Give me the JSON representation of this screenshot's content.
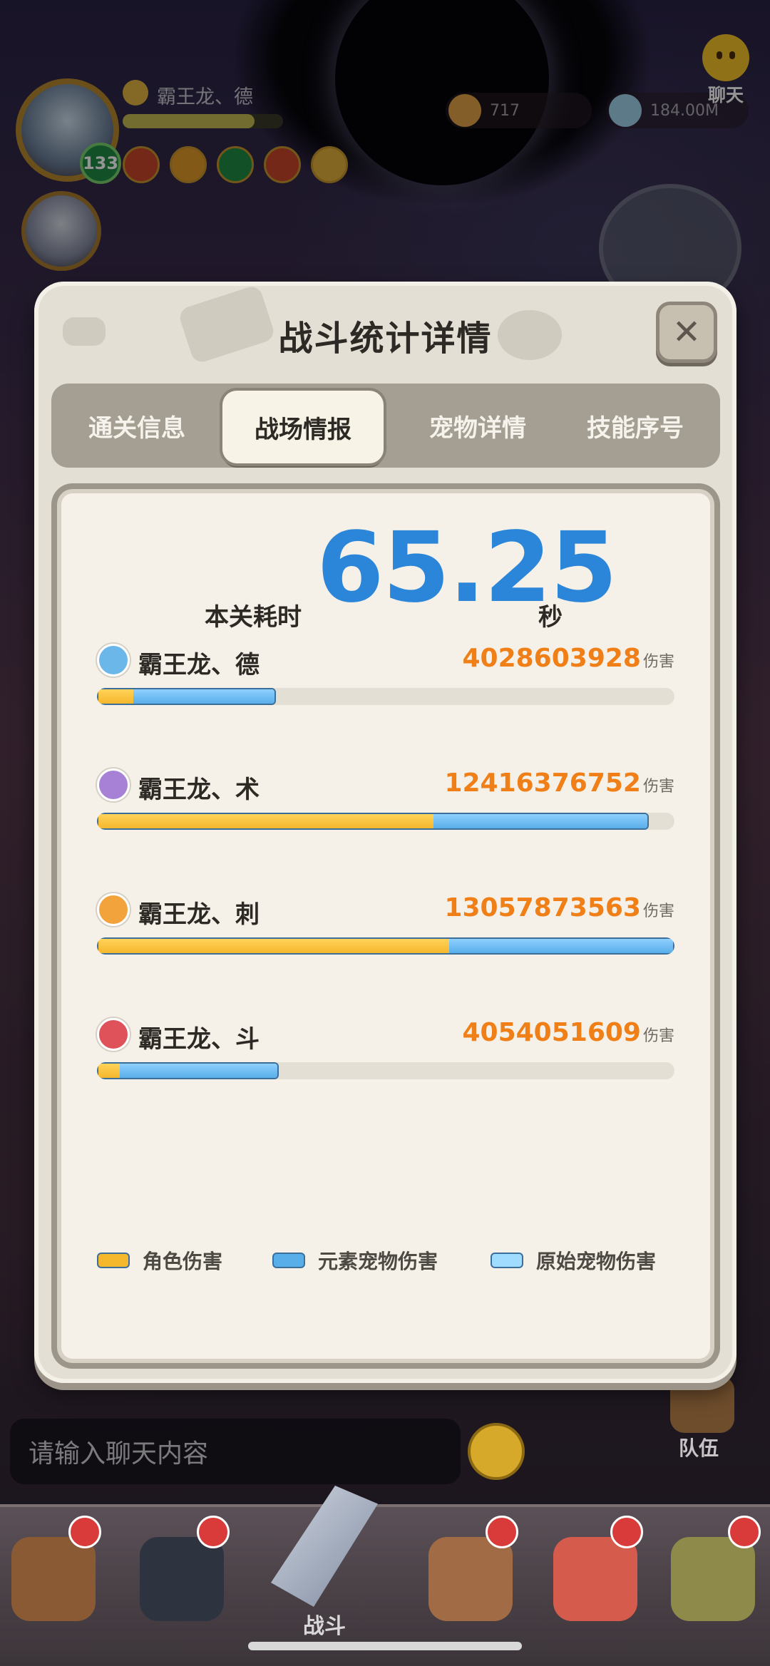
{
  "background": {
    "player_name": "霸王龙、德",
    "level": "133",
    "resource_gold": "717",
    "resource_gems": "184.00M",
    "chat_button": "聊天",
    "chat_placeholder": "请输入聊天内容",
    "team_label": "队伍"
  },
  "modal": {
    "title": "战斗统计详情",
    "close": "✕",
    "tabs": [
      {
        "label": "通关信息",
        "active": false
      },
      {
        "label": "战场情报",
        "active": true
      },
      {
        "label": "宠物详情",
        "active": false
      },
      {
        "label": "技能序号",
        "active": false
      }
    ],
    "time_label": "本关耗时",
    "time_value": "65.25",
    "time_unit": "秒",
    "damage_unit": "伤害",
    "heroes": [
      {
        "name": "霸王龙、德",
        "damage": "4028603928",
        "icon_color": "#6bb7ea",
        "icon": "water-element-icon",
        "bar_total": 0.31,
        "yellow_share": 0.2
      },
      {
        "name": "霸王龙、术",
        "damage": "12416376752",
        "icon_color": "#a781d6",
        "icon": "arcane-element-icon",
        "bar_total": 0.955,
        "yellow_share": 0.61
      },
      {
        "name": "霸王龙、刺",
        "damage": "13057873563",
        "icon_color": "#f2a33c",
        "icon": "fire-element-icon",
        "bar_total": 1.0,
        "yellow_share": 0.61
      },
      {
        "name": "霸王龙、斗",
        "damage": "4054051609",
        "icon_color": "#e0525a",
        "icon": "blood-element-icon",
        "bar_total": 0.315,
        "yellow_share": 0.12
      }
    ],
    "legend": [
      {
        "label": "角色伤害",
        "color": "#f5b72c"
      },
      {
        "label": "元素宠物伤害",
        "color": "#58aee9"
      },
      {
        "label": "原始宠物伤害",
        "color": "#9fdcff"
      }
    ]
  },
  "navbar": {
    "center_label": "战斗"
  }
}
